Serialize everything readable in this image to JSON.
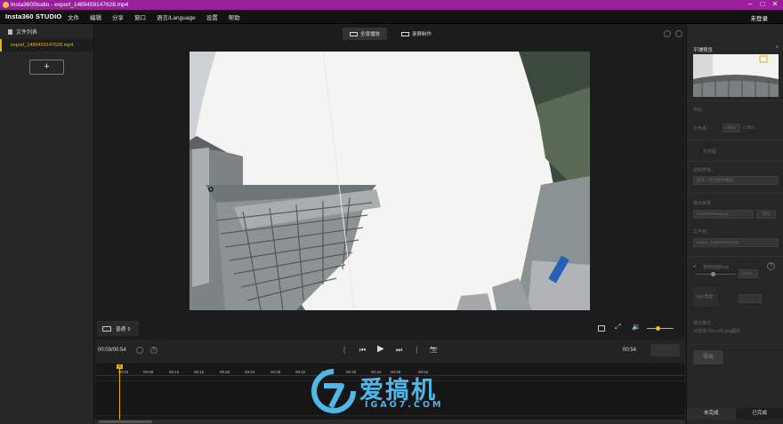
{
  "window": {
    "title": "Insta360Studio - export_1489459147628.mp4",
    "minimize": "–",
    "maximize": "□",
    "close": "✕"
  },
  "menubar": {
    "logo": "Insta360 STUDIO",
    "items": [
      "文件",
      "编辑",
      "分享",
      "窗口",
      "语言/Language",
      "设置",
      "帮助"
    ],
    "login": "未登录"
  },
  "file_panel": {
    "title": "文件列表",
    "files": [
      "export_1489459147628.mp4"
    ],
    "add_label": "+"
  },
  "view_tabs": {
    "panorama": "全景播放",
    "record": "录屏制作"
  },
  "player": {
    "view_mode": "普通 ⇕",
    "current_time": "00:03/00:54",
    "end_time": "00:54",
    "help": "?",
    "volume_level": 0.4
  },
  "timeline": {
    "ticks": [
      "00:04",
      "00:08",
      "00:12",
      "00:16",
      "00:20",
      "00:24",
      "00:28",
      "00:32",
      "00:36",
      "00:40",
      "00:44",
      "00:48",
      "00:52"
    ],
    "playhead_label": "00"
  },
  "right_panel": {
    "title": "平铺预览",
    "close": "×",
    "section_export": "导出",
    "resolution_label": "分辨率：",
    "resolution_w": "1920",
    "resolution_h": "x 960",
    "fullscreen_label": "全景图",
    "video_quality_label": "视频质量：",
    "video_quality_value": "超清（适合网络播放）",
    "output_dir_label": "输出目录",
    "output_dir_value": "C:\\Users\\Desktop",
    "browse": "浏览",
    "filename_label": "文件名：",
    "filename_value": "export_1489459147628",
    "watermark_label": "使用画面logo",
    "watermark_help": "?",
    "opacity_value": "100%",
    "logo_size_label": "logo宽度",
    "logo_size_value": "",
    "format_label": "建议格式：",
    "format_value": "分辨率100x100,png图片",
    "export": "导出",
    "tabs": [
      "未完成",
      "已完成"
    ]
  },
  "watermark": {
    "brand": "爱搞机",
    "url": "IGAO7.COM"
  }
}
